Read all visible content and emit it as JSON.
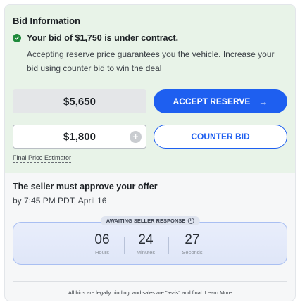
{
  "bid_info": {
    "title": "Bid Information",
    "status_main": "Your bid of $1,750 is under contract.",
    "status_sub": "Accepting reserve price guarantees you the vehicle. Increase your bid using counter bid to win the deal",
    "reserve_price": "$5,650",
    "accept_label": "ACCEPT RESERVE",
    "bid_value": "$1,800",
    "counter_label": "COUNTER BID",
    "estimator_label": "Final Price Estimator"
  },
  "approval": {
    "title": "The seller must approve your offer",
    "deadline": "by 7:45 PM PDT, April 16",
    "badge": "AWAITING SELLER RESPONSE",
    "timer": [
      {
        "value": "06",
        "unit": "Hours"
      },
      {
        "value": "24",
        "unit": "Minutes"
      },
      {
        "value": "27",
        "unit": "Seconds"
      }
    ]
  },
  "footer": {
    "text": "All bids are legally binding, and sales are \"as-is\" and final.",
    "link": "Learn More"
  },
  "colors": {
    "accent": "#1e5ff0",
    "success": "#1f8a3b",
    "panel_green": "#e8f3e8"
  }
}
